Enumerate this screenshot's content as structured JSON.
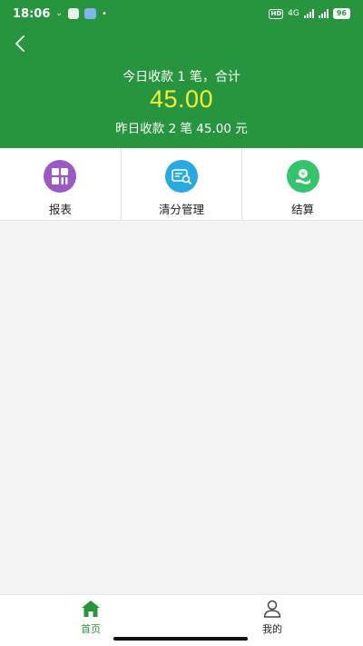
{
  "status_bar": {
    "time": "18:06",
    "network": "4G",
    "battery": "96"
  },
  "header": {
    "today_summary": "今日收款 1 笔，合计",
    "today_amount": "45.00",
    "yesterday_summary": "昨日收款 2 笔 45.00 元",
    "background_color": "#27953d",
    "amount_color": "#f4ef33"
  },
  "menu": [
    {
      "label": "报表",
      "icon": "report-grid-icon",
      "color": "#9b59c6"
    },
    {
      "label": "清分管理",
      "icon": "card-search-icon",
      "color": "#2aa9e0"
    },
    {
      "label": "结算",
      "icon": "settlement-hand-icon",
      "color": "#35c46b"
    }
  ],
  "tabbar": {
    "home_label": "首页",
    "mine_label": "我的",
    "active_color": "#27953d"
  }
}
